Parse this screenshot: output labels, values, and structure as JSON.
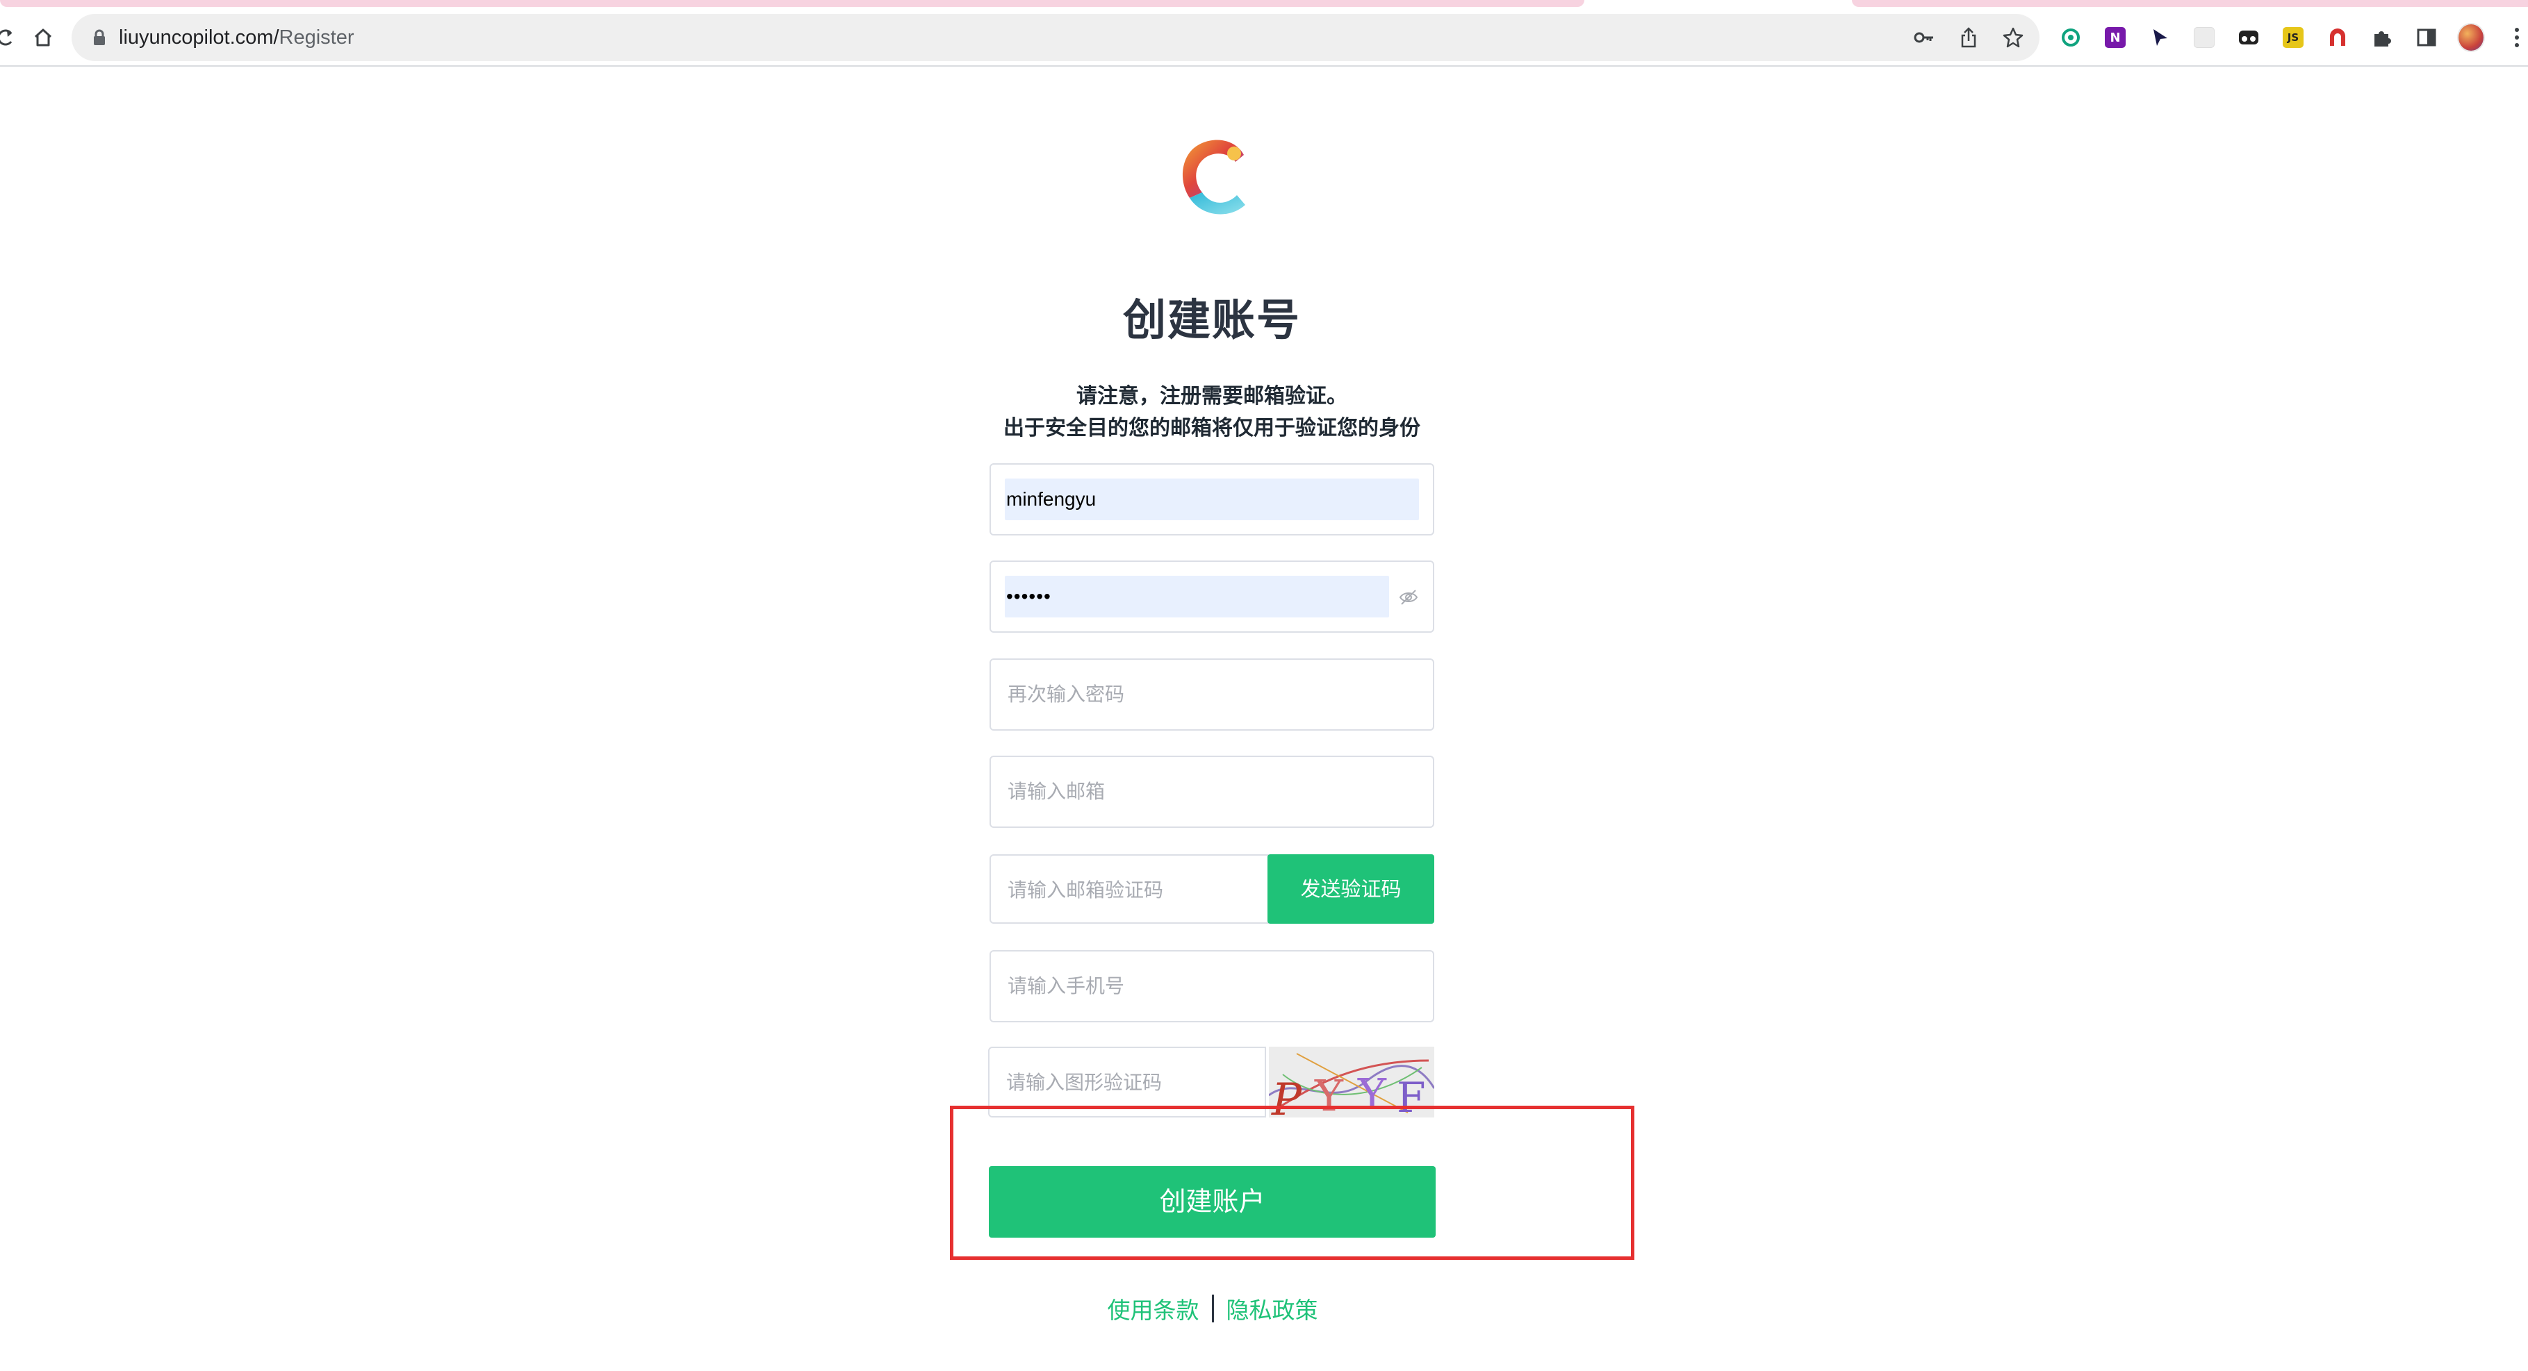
{
  "browser": {
    "url_host": "liuyuncopilot.com/",
    "url_path": "Register",
    "extensions": [
      {
        "name": "openai-ext-icon",
        "color": "#10a37f"
      },
      {
        "name": "onenote-ext-icon",
        "color": "#7719aa",
        "label": "N"
      },
      {
        "name": "cursor-ext-icon",
        "color": "#1a1a4a"
      },
      {
        "name": "blank-ext-icon",
        "color": "#e8e8e8"
      },
      {
        "name": "mask-ext-icon",
        "color": "#222222"
      },
      {
        "name": "js-ext-icon",
        "color": "#e6c619",
        "label": "JS"
      },
      {
        "name": "red-ext-icon",
        "color": "#d6312f"
      },
      {
        "name": "puzzle-ext-icon",
        "color": "#3c4043"
      },
      {
        "name": "sidepanel-ext-icon",
        "color": "#3c4043"
      }
    ]
  },
  "page": {
    "title": "创建账号",
    "notice_line1": "请注意，注册需要邮箱验证。",
    "notice_line2": "出于安全目的您的邮箱将仅用于验证您的身份"
  },
  "form": {
    "username_value": "minfengyu",
    "password_value": "••••••",
    "confirm_password_placeholder": "再次输入密码",
    "email_placeholder": "请输入邮箱",
    "email_code_placeholder": "请输入邮箱验证码",
    "send_code_label": "发送验证码",
    "phone_placeholder": "请输入手机号",
    "captcha_placeholder": "请输入图形验证码",
    "captcha_text": "PYYF",
    "submit_label": "创建账户"
  },
  "footer": {
    "terms_label": "使用条款",
    "privacy_label": "隐私政策"
  },
  "colors": {
    "accent": "#1fc278",
    "highlight": "#e63030"
  }
}
